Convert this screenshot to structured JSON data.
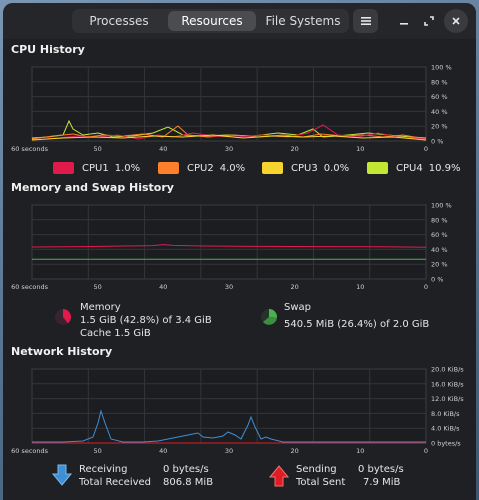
{
  "tabs": [
    {
      "label": "Processes"
    },
    {
      "label": "Resources",
      "active": true
    },
    {
      "label": "File Systems"
    }
  ],
  "cpu": {
    "title": "CPU History",
    "y_ticks": [
      "100 %",
      "80 %",
      "60 %",
      "40 %",
      "20 %",
      "0 %"
    ],
    "x_ticks": [
      "60 seconds",
      "50",
      "40",
      "30",
      "20",
      "10",
      "0"
    ],
    "legend": [
      {
        "name": "CPU1",
        "value": "1.0%",
        "color": "#e01b4c"
      },
      {
        "name": "CPU2",
        "value": "4.0%",
        "color": "#ff7f2a"
      },
      {
        "name": "CPU3",
        "value": "0.0%",
        "color": "#f6d32d"
      },
      {
        "name": "CPU4",
        "value": "10.9%",
        "color": "#c3e834"
      }
    ]
  },
  "memory": {
    "title": "Memory and Swap History",
    "y_ticks": [
      "100 %",
      "80 %",
      "60 %",
      "40 %",
      "20 %",
      "0 %"
    ],
    "x_ticks": [
      "60 seconds",
      "50",
      "40",
      "30",
      "20",
      "10",
      "0"
    ],
    "mem_label": "Memory",
    "mem_value": "1.5 GiB (42.8%) of 3.4 GiB",
    "cache": "Cache 1.5 GiB",
    "swap_label": "Swap",
    "swap_value": "540.5 MiB (26.4%) of 2.0 GiB",
    "mem_color": "#e01b4c",
    "swap_color": "#4caf50"
  },
  "network": {
    "title": "Network History",
    "y_ticks": [
      "20.0 KiB/s",
      "16.0 KiB/s",
      "12.0 KiB/s",
      "8.0 KiB/s",
      "4.0 KiB/s",
      "0 bytes/s"
    ],
    "x_ticks": [
      "60 seconds",
      "50",
      "40",
      "30",
      "20",
      "10",
      "0"
    ],
    "receiving_label": "Receiving",
    "receiving_rate": "0 bytes/s",
    "total_received_label": "Total Received",
    "total_received": "806.8 MiB",
    "sending_label": "Sending",
    "sending_rate": "0 bytes/s",
    "total_sent_label": "Total Sent",
    "total_sent": "7.9 MiB",
    "recv_color": "#3d8fd6",
    "send_color": "#e01b24"
  }
}
